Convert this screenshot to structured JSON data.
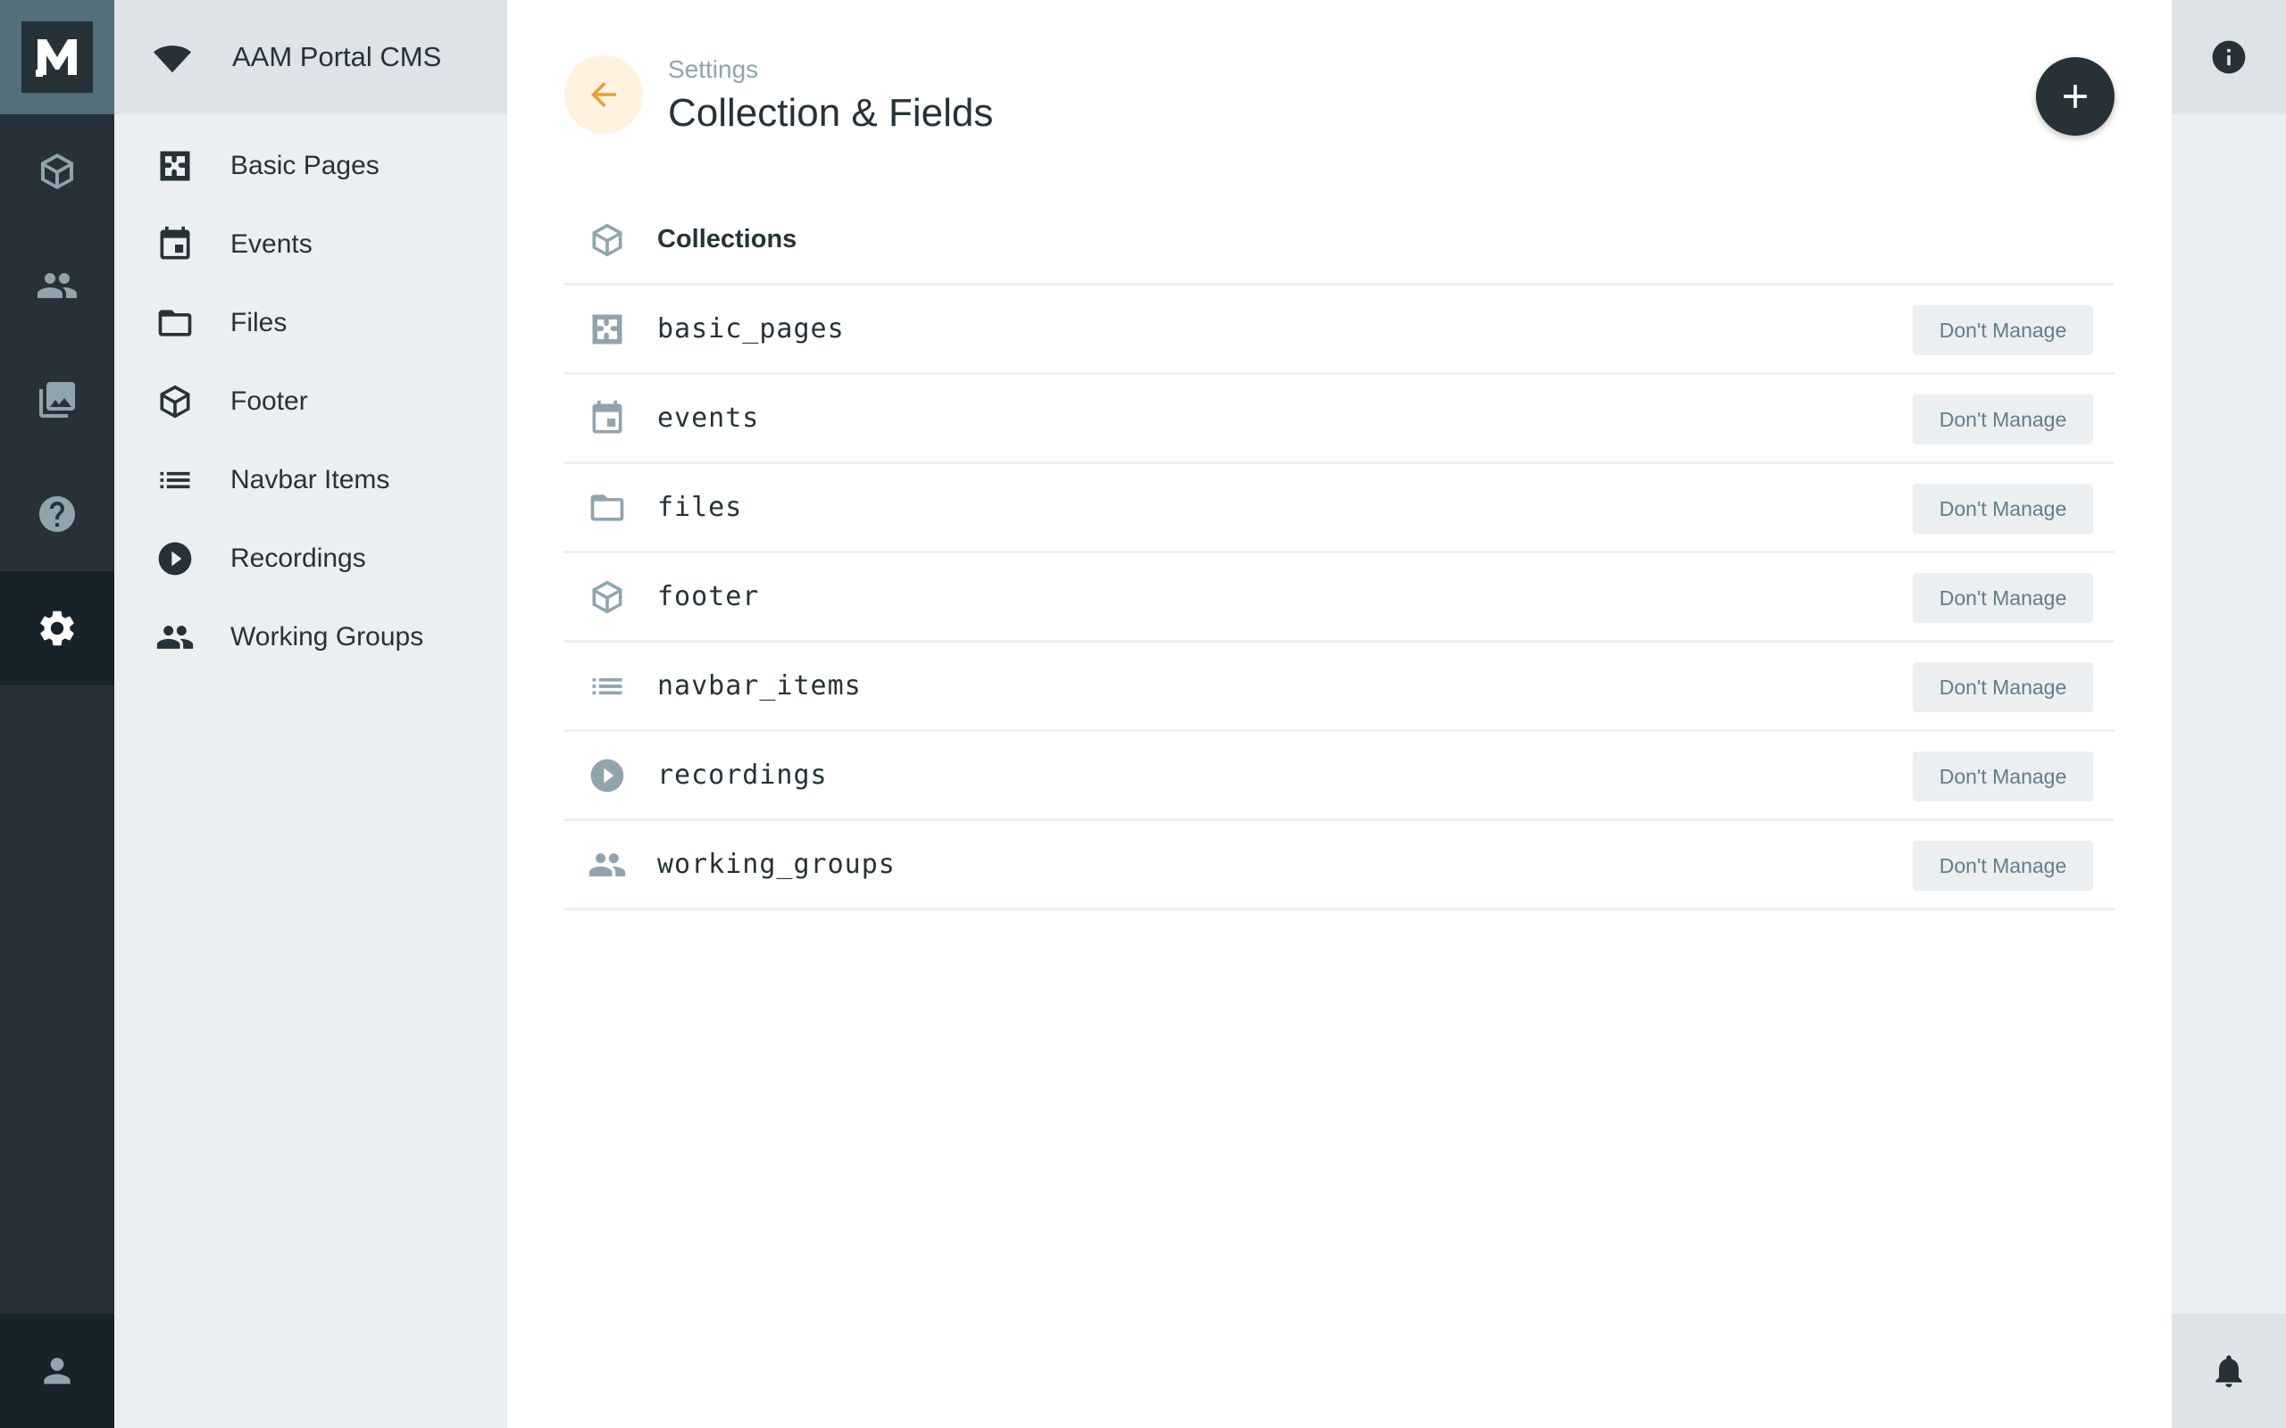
{
  "app": {
    "logo_letter": "M",
    "project_name": "AAM Portal CMS",
    "accent_color": "#f29a2e",
    "dark_color": "#263238"
  },
  "modules": [
    {
      "name": "collections",
      "icon": "box-icon",
      "active": false
    },
    {
      "name": "users",
      "icon": "people-icon",
      "active": false
    },
    {
      "name": "files",
      "icon": "photo-library-icon",
      "active": false
    },
    {
      "name": "help",
      "icon": "help-icon",
      "active": false
    },
    {
      "name": "settings",
      "icon": "gear-icon",
      "active": true
    }
  ],
  "nav": {
    "items": [
      {
        "label": "Basic Pages",
        "icon": "extension-icon"
      },
      {
        "label": "Events",
        "icon": "calendar-icon"
      },
      {
        "label": "Files",
        "icon": "folder-icon"
      },
      {
        "label": "Footer",
        "icon": "box-icon"
      },
      {
        "label": "Navbar Items",
        "icon": "list-icon"
      },
      {
        "label": "Recordings",
        "icon": "play-circle-icon"
      },
      {
        "label": "Working Groups",
        "icon": "people-icon"
      }
    ]
  },
  "header": {
    "breadcrumb": "Settings",
    "title": "Collection & Fields"
  },
  "table": {
    "header_label": "Collections",
    "button_label": "Don't Manage",
    "rows": [
      {
        "name": "basic_pages",
        "icon": "extension-icon"
      },
      {
        "name": "events",
        "icon": "calendar-icon"
      },
      {
        "name": "files",
        "icon": "folder-icon"
      },
      {
        "name": "footer",
        "icon": "box-icon"
      },
      {
        "name": "navbar_items",
        "icon": "list-icon"
      },
      {
        "name": "recordings",
        "icon": "play-circle-icon"
      },
      {
        "name": "working_groups",
        "icon": "people-icon"
      }
    ]
  }
}
